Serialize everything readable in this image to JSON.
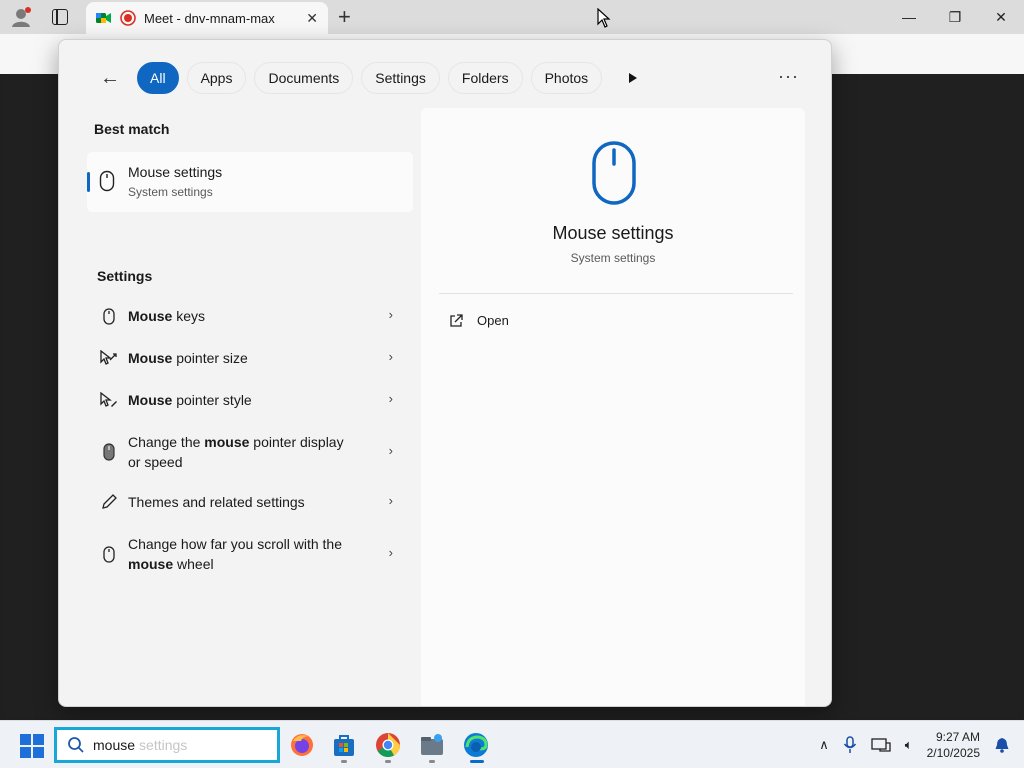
{
  "browser": {
    "tab_title": "Meet - dnv-mnam-max",
    "tab_close": "✕",
    "new_tab": "+",
    "minimize": "—",
    "restore": "❐",
    "close": "✕",
    "toolbar_more": "···"
  },
  "search_panel": {
    "filters": [
      "All",
      "Apps",
      "Documents",
      "Settings",
      "Folders",
      "Photos"
    ],
    "active_filter": "All",
    "more": "···",
    "best_match_label": "Best match",
    "best_match": {
      "title": "Mouse settings",
      "subtitle": "System settings",
      "icon": "mouse-icon"
    },
    "settings_label": "Settings",
    "results": [
      {
        "pre": "",
        "bold": "Mouse",
        "post": " keys",
        "line2": "",
        "icon": "mouse-icon"
      },
      {
        "pre": "",
        "bold": "Mouse",
        "post": " pointer size",
        "line2": "",
        "icon": "pointer-size-icon"
      },
      {
        "pre": "",
        "bold": "Mouse",
        "post": " pointer style",
        "line2": "",
        "icon": "pointer-style-icon"
      },
      {
        "pre": "Change the ",
        "bold": "mouse",
        "post": " pointer display",
        "line2": "or speed",
        "icon": "mouse-dark-icon"
      },
      {
        "pre": "Themes and related settings",
        "bold": "",
        "post": "",
        "line2": "",
        "icon": "pen-icon"
      },
      {
        "pre": "Change how far you scroll with the",
        "bold": "",
        "post": "",
        "line2_bold": "mouse",
        "line2": " wheel",
        "icon": "mouse-icon"
      }
    ],
    "chevron": "›",
    "preview": {
      "title": "Mouse settings",
      "subtitle": "System settings",
      "open_label": "Open"
    }
  },
  "taskbar": {
    "search_value": "mouse",
    "search_hint": "settings",
    "time": "9:27 AM",
    "date": "2/10/2025",
    "tray_chevron": "∧"
  },
  "colors": {
    "accent": "#0f67c2",
    "search_border": "#18a7d8"
  }
}
